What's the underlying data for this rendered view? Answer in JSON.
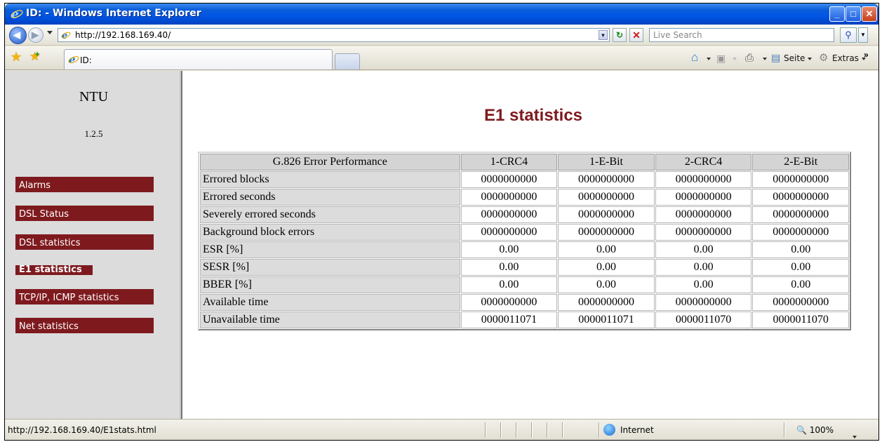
{
  "window": {
    "title": "ID: - Windows Internet Explorer",
    "controls": [
      "minimize-icon",
      "maximize-icon",
      "close-icon"
    ]
  },
  "address_bar": {
    "url": "http://192.168.169.40/",
    "search_placeholder": "Live Search"
  },
  "tab_bar": {
    "active_tab_label": "ID:",
    "commands": {
      "page_label": "Seite",
      "tools_label": "Extras",
      "icons": [
        "home-icon",
        "feeds-icon",
        "print-icon",
        "page-icon",
        "tools-gear-icon"
      ]
    }
  },
  "sidebar": {
    "title": "NTU",
    "version": "1.2.5",
    "items": [
      {
        "label": "Alarms",
        "active": false
      },
      {
        "label": "DSL Status",
        "active": false
      },
      {
        "label": "DSL statistics",
        "active": false
      },
      {
        "label": "E1 statistics",
        "active": true
      },
      {
        "label": "TCP/IP, ICMP statistics",
        "active": false
      },
      {
        "label": "Net statistics",
        "active": false
      }
    ]
  },
  "main": {
    "title": "E1 statistics",
    "table": {
      "headers": [
        "G.826 Error Performance",
        "1-CRC4",
        "1-E-Bit",
        "2-CRC4",
        "2-E-Bit"
      ],
      "rows": [
        {
          "label": "Errored blocks",
          "values": [
            "0000000000",
            "0000000000",
            "0000000000",
            "0000000000"
          ]
        },
        {
          "label": "Errored seconds",
          "values": [
            "0000000000",
            "0000000000",
            "0000000000",
            "0000000000"
          ]
        },
        {
          "label": "Severely errored seconds",
          "values": [
            "0000000000",
            "0000000000",
            "0000000000",
            "0000000000"
          ]
        },
        {
          "label": "Background block errors",
          "values": [
            "0000000000",
            "0000000000",
            "0000000000",
            "0000000000"
          ]
        },
        {
          "label": "ESR [%]",
          "values": [
            "0.00",
            "0.00",
            "0.00",
            "0.00"
          ]
        },
        {
          "label": "SESR [%]",
          "values": [
            "0.00",
            "0.00",
            "0.00",
            "0.00"
          ]
        },
        {
          "label": "BBER [%]",
          "values": [
            "0.00",
            "0.00",
            "0.00",
            "0.00"
          ]
        },
        {
          "label": "Available time",
          "values": [
            "0000000000",
            "0000000000",
            "0000000000",
            "0000000000"
          ]
        },
        {
          "label": "Unavailable time",
          "values": [
            "0000011071",
            "0000011071",
            "0000011070",
            "0000011070"
          ]
        }
      ]
    }
  },
  "status_bar": {
    "text": "http://192.168.169.40/E1stats.html",
    "zone": "Internet",
    "zoom": "100%"
  },
  "colors": {
    "accent": "#7e1a1e",
    "sidebar_bg": "#dcdcdc",
    "titlebar": "#0055e5"
  }
}
